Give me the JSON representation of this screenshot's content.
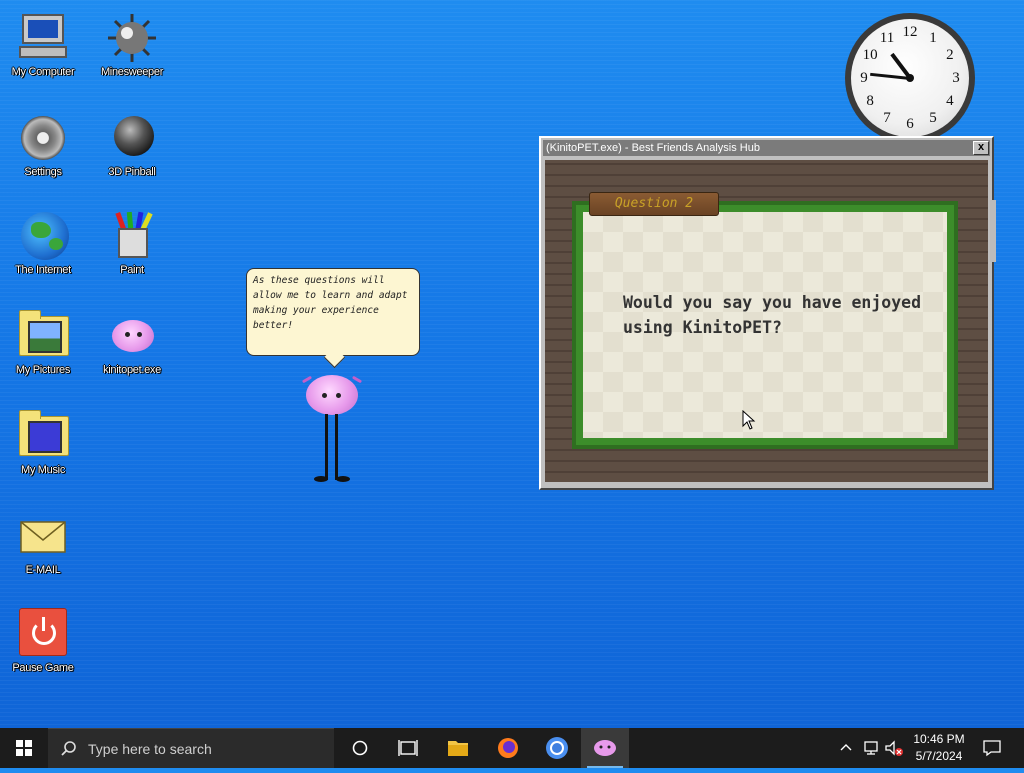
{
  "desktop_icons": [
    {
      "label": "My Computer",
      "icon": "computer-icon"
    },
    {
      "label": "Minesweeper",
      "icon": "mine-icon"
    },
    {
      "label": "Settings",
      "icon": "gear-icon"
    },
    {
      "label": "3D Pinball",
      "icon": "pinball-icon"
    },
    {
      "label": "The Internet",
      "icon": "globe-icon"
    },
    {
      "label": "Paint",
      "icon": "paint-icon"
    },
    {
      "label": "My Pictures",
      "icon": "pictures-folder-icon"
    },
    {
      "label": "kinitopet.exe",
      "icon": "axolotl-icon"
    },
    {
      "label": "My Music",
      "icon": "music-folder-icon"
    },
    {
      "label": "E-MAIL",
      "icon": "envelope-icon"
    },
    {
      "label": "Pause Game",
      "icon": "power-icon"
    }
  ],
  "clock": {
    "numbers": [
      "12",
      "1",
      "2",
      "3",
      "4",
      "5",
      "6",
      "7",
      "8",
      "9",
      "10",
      "11"
    ],
    "time": {
      "hour": 10,
      "minute": 46
    }
  },
  "speech_bubble": {
    "text": "As these questions will allow me to learn and adapt making your experience better!"
  },
  "window": {
    "title": "(KinitoPET.exe) - Best Friends Analysis Hub",
    "close_label": "x",
    "sign_label": "Question 2",
    "question": "Would you say you have enjoyed using KinitoPET?"
  },
  "taskbar": {
    "search_placeholder": "Type here to search",
    "time": "10:46 PM",
    "date": "5/7/2024"
  },
  "colors": {
    "desktop": "#1577e6",
    "taskbar": "#1c1c1c",
    "window_title": "#7b7b7b",
    "vine_green": "#3c8d2a",
    "sign_text": "#c9a227"
  }
}
